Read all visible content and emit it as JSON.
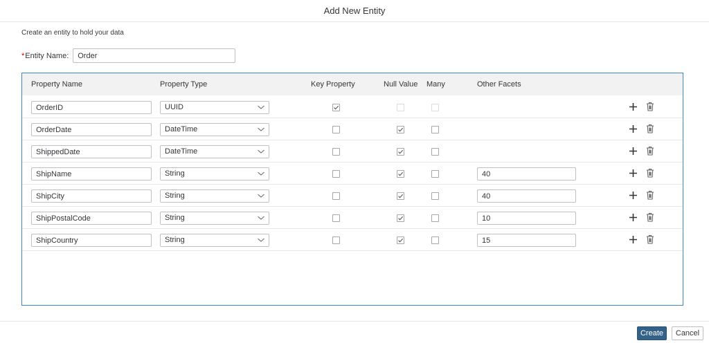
{
  "dialog": {
    "title": "Add New Entity",
    "subtitle": "Create an entity to hold your data"
  },
  "entity": {
    "required_mark": "*",
    "label": "Entity Name:",
    "value": "Order"
  },
  "table": {
    "headers": {
      "property_name": "Property Name",
      "property_type": "Property Type",
      "key_property": "Key Property",
      "null_value": "Null Value",
      "many": "Many",
      "other_facets": "Other Facets"
    },
    "rows": [
      {
        "name": "OrderID",
        "type": "UUID",
        "key": true,
        "null_value": false,
        "many": false,
        "facets": "",
        "disabled_null_many": true
      },
      {
        "name": "OrderDate",
        "type": "DateTime",
        "key": false,
        "null_value": true,
        "many": false,
        "facets": "",
        "disabled_null_many": false
      },
      {
        "name": "ShippedDate",
        "type": "DateTime",
        "key": false,
        "null_value": true,
        "many": false,
        "facets": "",
        "disabled_null_many": false
      },
      {
        "name": "ShipName",
        "type": "String",
        "key": false,
        "null_value": true,
        "many": false,
        "facets": "40",
        "disabled_null_many": false
      },
      {
        "name": "ShipCity",
        "type": "String",
        "key": false,
        "null_value": true,
        "many": false,
        "facets": "40",
        "disabled_null_many": false
      },
      {
        "name": "ShipPostalCode",
        "type": "String",
        "key": false,
        "null_value": true,
        "many": false,
        "facets": "10",
        "disabled_null_many": false
      },
      {
        "name": "ShipCountry",
        "type": "String",
        "key": false,
        "null_value": true,
        "many": false,
        "facets": "15",
        "disabled_null_many": false
      }
    ]
  },
  "footer": {
    "create_label": "Create",
    "cancel_label": "Cancel"
  },
  "icons": {
    "add": "add-icon",
    "delete": "trash-icon",
    "dropdown": "chevron-down-icon",
    "check": "check-icon"
  },
  "colors": {
    "accent": "#346187",
    "panel_border": "#3a85c6",
    "required": "#bb0000",
    "header_bg": "#f2f2f2"
  }
}
